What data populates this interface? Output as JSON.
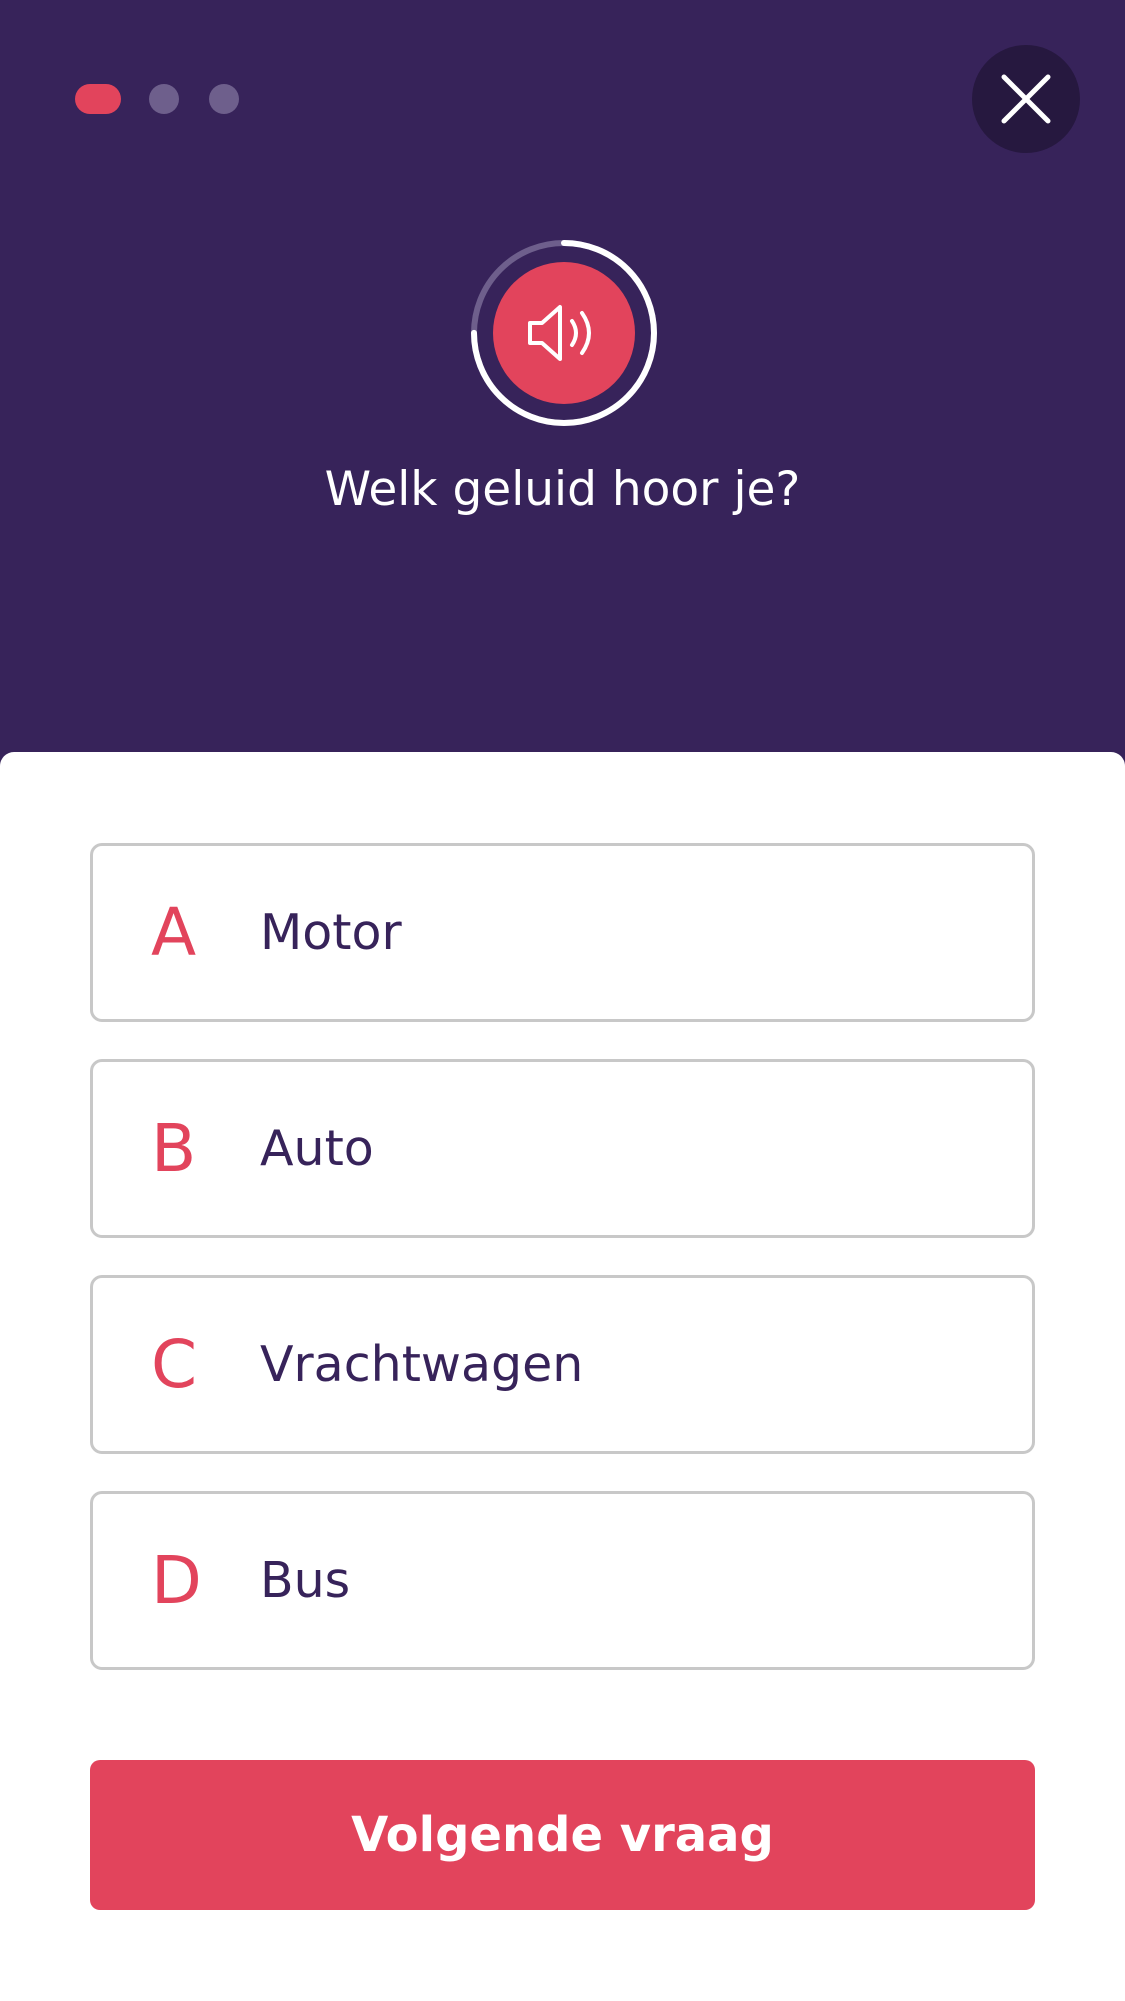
{
  "quiz": {
    "progress": {
      "current_step": 1,
      "total_steps": 3
    },
    "close_icon": "close-icon",
    "audio": {
      "icon": "speaker-icon",
      "playback_progress": 0.75
    },
    "question": "Welk geluid hoor je?",
    "options": [
      {
        "letter": "A",
        "label": "Motor"
      },
      {
        "letter": "B",
        "label": "Auto"
      },
      {
        "letter": "C",
        "label": "Vrachtwagen"
      },
      {
        "letter": "D",
        "label": "Bus"
      }
    ],
    "next_button_label": "Volgende vraag"
  },
  "colors": {
    "header_background": "#37235a",
    "accent": "#e2445c",
    "text_dark": "#37235a",
    "option_border": "#c8c8c8",
    "inactive_dot": "#6e5f8c"
  }
}
